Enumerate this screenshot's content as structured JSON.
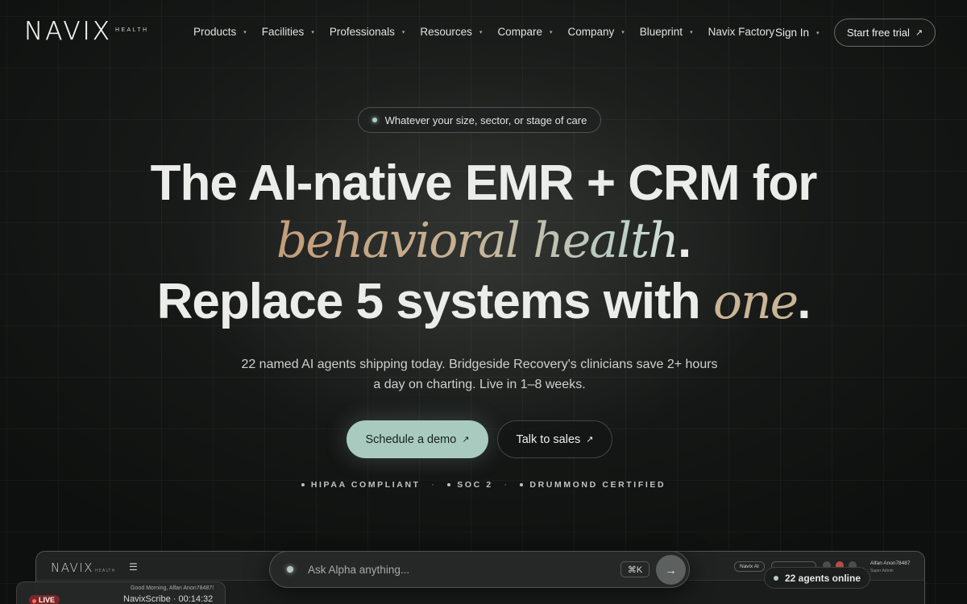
{
  "brand": {
    "name": "NAVIX",
    "suffix": "HEALTH"
  },
  "nav": {
    "items": [
      {
        "label": "Products",
        "has_menu": true
      },
      {
        "label": "Facilities",
        "has_menu": true
      },
      {
        "label": "Professionals",
        "has_menu": true
      },
      {
        "label": "Resources",
        "has_menu": true
      },
      {
        "label": "Compare",
        "has_menu": true
      },
      {
        "label": "Company",
        "has_menu": true
      },
      {
        "label": "Blueprint",
        "has_menu": true
      },
      {
        "label": "Navix Factory",
        "has_menu": false
      }
    ],
    "sign_in": "Sign In",
    "trial_button": "Start free trial",
    "caret_glyph": "▾",
    "arrow_glyph": "↗"
  },
  "hero": {
    "pill": "Whatever your size, sector, or stage of care",
    "line1": "The AI-native EMR + CRM for",
    "line2_em": "behavioral health",
    "line2_end": ".",
    "line3_start": "Replace 5 systems with ",
    "line3_em": "one",
    "line3_end": ".",
    "subtitle_1": "22 named AI agents shipping today. Bridgeside Recovery's clinicians save 2+ hours",
    "subtitle_2": "a day on charting. Live in 1–8 weeks.",
    "cta_primary": "Schedule a demo",
    "cta_secondary": "Talk to sales",
    "certifications": [
      "HIPAA COMPLIANT",
      "SOC 2",
      "DRUMMOND CERTIFIED"
    ],
    "cert_separator": "·"
  },
  "preview": {
    "logo": "NAVIX",
    "logo_sub": "HEALTH",
    "navi_ai": "Navix AI",
    "user": "Alfan Anon78487",
    "role": "Super Admin",
    "greeting": "Good Morning, Alfan Anon78487!",
    "live": "LIVE",
    "scribe": "NavixScribe · 00:14:32",
    "ask_placeholder": "Ask Alpha anything...",
    "shortcut": "⌘K",
    "send_glyph": "→",
    "agents_online": "22 agents online"
  },
  "colors": {
    "accent_mint": "#a9cbbf",
    "gradient_gold": "#c39d7a",
    "gradient_teal": "#b9cdc4",
    "background": "#111413"
  },
  "icons": [
    "chevron-down-icon",
    "arrow-up-right-icon",
    "menu-icon",
    "arrow-right-icon",
    "status-dot-icon"
  ]
}
